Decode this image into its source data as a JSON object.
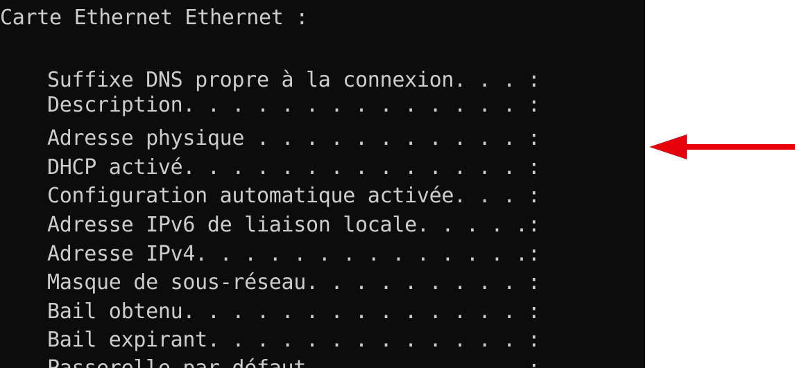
{
  "terminal": {
    "heading": "Carte Ethernet Ethernet :",
    "entries": [
      "Suffixe DNS propre à la connexion. . . :",
      "Description. . . . . . . . . . . . . . :",
      "Adresse physique . . . . . . . . . . . :",
      "DHCP activé. . . . . . . . . . . . . . :",
      "Configuration automatique activée. . . :",
      "Adresse IPv6 de liaison locale. . . . .:",
      "Adresse IPv4. . . . . . . . . . . . . .:",
      "Masque de sous-réseau. . . . . . . . . :",
      "Bail obtenu. . . . . . . . . . . . . . :",
      "Bail expirant. . . . . . . . . . . . . :",
      "Passerelle par défaut. . . . . . . . . :"
    ]
  },
  "annotation": {
    "arrow_color": "#e8000b",
    "arrow_target": "Adresse physique"
  }
}
